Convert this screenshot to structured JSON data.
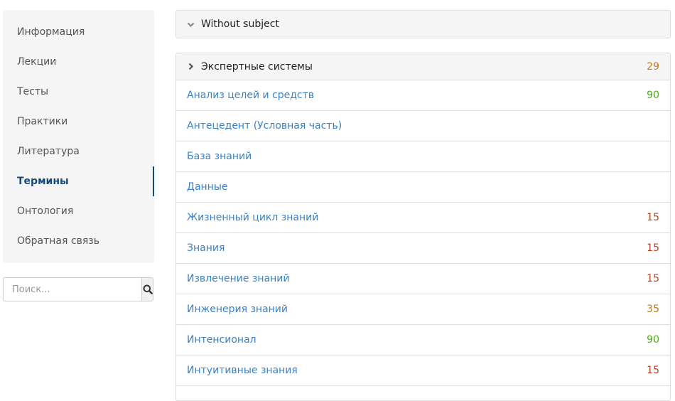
{
  "sidebar": {
    "items": [
      {
        "label": "Информация"
      },
      {
        "label": "Лекции"
      },
      {
        "label": "Тесты"
      },
      {
        "label": "Практики"
      },
      {
        "label": "Литература"
      },
      {
        "label": "Термины",
        "active": true
      },
      {
        "label": "Онтология"
      },
      {
        "label": "Обратная связь"
      }
    ]
  },
  "search": {
    "placeholder": "Поиск...",
    "value": "",
    "icon": "search-icon"
  },
  "panel_top": {
    "title": "Without subject",
    "icon": "chevron-down-icon"
  },
  "panel_main": {
    "title": "Экспертные системы",
    "count": "29",
    "icon": "chevron-right-icon",
    "terms": [
      {
        "label": "Анализ целей и средств",
        "count": "90"
      },
      {
        "label": "Антецедент (Условная часть)",
        "count": ""
      },
      {
        "label": "База знаний",
        "count": ""
      },
      {
        "label": "Данные",
        "count": ""
      },
      {
        "label": "Жизненный цикл знаний",
        "count": "15"
      },
      {
        "label": "Знания",
        "count": "15"
      },
      {
        "label": "Извлечение знаний",
        "count": "15"
      },
      {
        "label": "Инженерия знаний",
        "count": "35"
      },
      {
        "label": "Интенсионал",
        "count": "90"
      },
      {
        "label": "Интуитивные знания",
        "count": "15"
      }
    ]
  },
  "colors": {
    "link": "#3a82c4",
    "active_nav": "#174a7c",
    "count_orange": "#c47a1a",
    "count_green": "#4cae1c",
    "count_red": "#c0421a"
  }
}
